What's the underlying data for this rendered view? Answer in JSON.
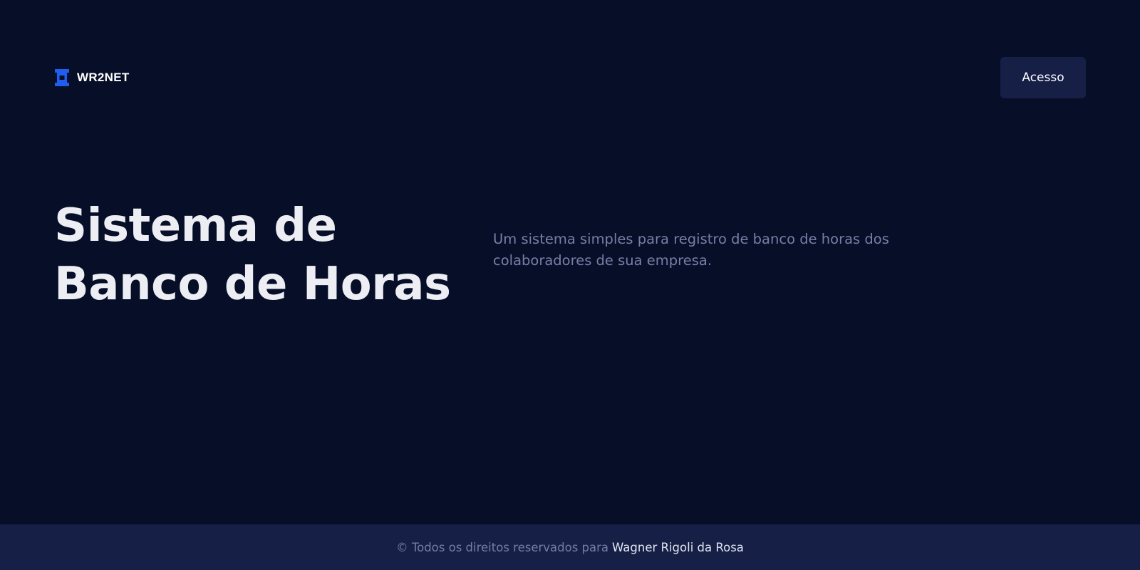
{
  "header": {
    "brand": "WR2NET",
    "access_button_label": "Acesso"
  },
  "hero": {
    "title_line1": "Sistema de",
    "title_line2": "Banco de Horas",
    "subtitle": "Um sistema simples para registro de banco de horas dos colaboradores de sua empresa."
  },
  "footer": {
    "rights_text": "© Todos os direitos reservados para",
    "author": "Wagner Rigoli da Rosa"
  },
  "colors": {
    "background": "#070e28",
    "surface": "#162047",
    "brand_accent": "#1f5cf0",
    "title_text": "#eceef3",
    "muted_text": "#7580a8"
  },
  "icons": {
    "logo": "brand-logo-icon"
  }
}
